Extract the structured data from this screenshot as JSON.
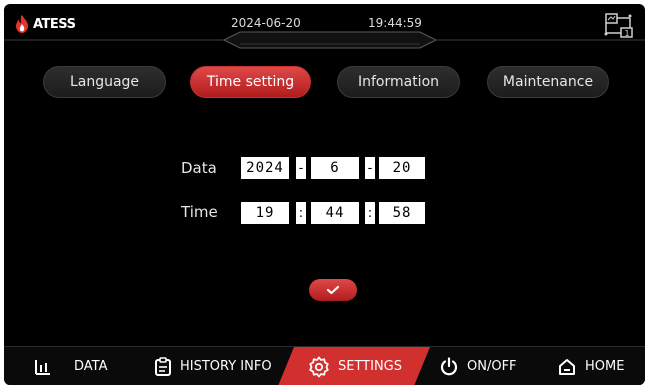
{
  "header": {
    "logo_text": "ATESS",
    "date": "2024-06-20",
    "time": "19:44:59"
  },
  "tabs": [
    {
      "label": "Language",
      "active": false
    },
    {
      "label": "Time setting",
      "active": true
    },
    {
      "label": "Information",
      "active": false
    },
    {
      "label": "Maintenance",
      "active": false
    }
  ],
  "form": {
    "date_label": "Data",
    "year": "2024",
    "month": "6",
    "day": "20",
    "date_sep": "-",
    "time_label": "Time",
    "hour": "19",
    "minute": "44",
    "second": "58",
    "time_sep": ":"
  },
  "nav": [
    {
      "label": "DATA",
      "icon": "bar-chart-icon"
    },
    {
      "label": "HISTORY INFO",
      "icon": "clipboard-icon"
    },
    {
      "label": "SETTINGS",
      "icon": "gear-icon",
      "active": true
    },
    {
      "label": "ON/OFF",
      "icon": "power-icon"
    },
    {
      "label": "HOME",
      "icon": "home-icon"
    }
  ],
  "colors": {
    "accent": "#c62a2a",
    "background": "#000000",
    "logo_flame": "#e3322b"
  }
}
